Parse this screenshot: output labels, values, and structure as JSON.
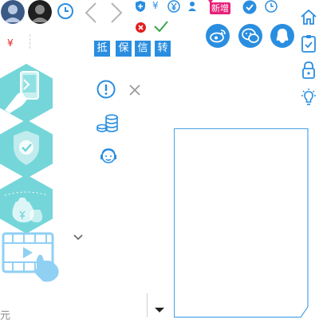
{
  "colors": {
    "accent": "#2a8ee0",
    "teal": "#6fd3d8",
    "light_blue": "#8fd0f3",
    "panel_border": "#4aa3e8",
    "red": "#e02020",
    "green": "#3aa64a"
  },
  "toolbar": {
    "yen_symbol": "¥",
    "new_badge": "新增",
    "tags": [
      "抵",
      "保",
      "信",
      "转"
    ]
  },
  "sidebar_left": {
    "yen_symbol": "¥"
  },
  "footer": {
    "currency_label": "元"
  }
}
